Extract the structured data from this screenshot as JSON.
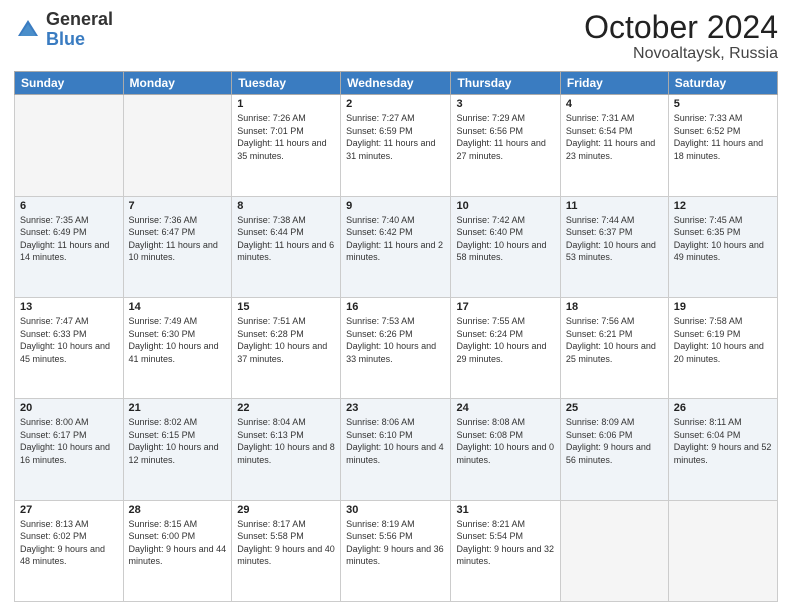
{
  "header": {
    "logo_general": "General",
    "logo_blue": "Blue",
    "month_title": "October 2024",
    "location": "Novoaltaysk, Russia"
  },
  "days_of_week": [
    "Sunday",
    "Monday",
    "Tuesday",
    "Wednesday",
    "Thursday",
    "Friday",
    "Saturday"
  ],
  "weeks": [
    [
      {
        "day": "",
        "empty": true
      },
      {
        "day": "",
        "empty": true
      },
      {
        "day": "1",
        "sunrise": "Sunrise: 7:26 AM",
        "sunset": "Sunset: 7:01 PM",
        "daylight": "Daylight: 11 hours and 35 minutes."
      },
      {
        "day": "2",
        "sunrise": "Sunrise: 7:27 AM",
        "sunset": "Sunset: 6:59 PM",
        "daylight": "Daylight: 11 hours and 31 minutes."
      },
      {
        "day": "3",
        "sunrise": "Sunrise: 7:29 AM",
        "sunset": "Sunset: 6:56 PM",
        "daylight": "Daylight: 11 hours and 27 minutes."
      },
      {
        "day": "4",
        "sunrise": "Sunrise: 7:31 AM",
        "sunset": "Sunset: 6:54 PM",
        "daylight": "Daylight: 11 hours and 23 minutes."
      },
      {
        "day": "5",
        "sunrise": "Sunrise: 7:33 AM",
        "sunset": "Sunset: 6:52 PM",
        "daylight": "Daylight: 11 hours and 18 minutes."
      }
    ],
    [
      {
        "day": "6",
        "sunrise": "Sunrise: 7:35 AM",
        "sunset": "Sunset: 6:49 PM",
        "daylight": "Daylight: 11 hours and 14 minutes."
      },
      {
        "day": "7",
        "sunrise": "Sunrise: 7:36 AM",
        "sunset": "Sunset: 6:47 PM",
        "daylight": "Daylight: 11 hours and 10 minutes."
      },
      {
        "day": "8",
        "sunrise": "Sunrise: 7:38 AM",
        "sunset": "Sunset: 6:44 PM",
        "daylight": "Daylight: 11 hours and 6 minutes."
      },
      {
        "day": "9",
        "sunrise": "Sunrise: 7:40 AM",
        "sunset": "Sunset: 6:42 PM",
        "daylight": "Daylight: 11 hours and 2 minutes."
      },
      {
        "day": "10",
        "sunrise": "Sunrise: 7:42 AM",
        "sunset": "Sunset: 6:40 PM",
        "daylight": "Daylight: 10 hours and 58 minutes."
      },
      {
        "day": "11",
        "sunrise": "Sunrise: 7:44 AM",
        "sunset": "Sunset: 6:37 PM",
        "daylight": "Daylight: 10 hours and 53 minutes."
      },
      {
        "day": "12",
        "sunrise": "Sunrise: 7:45 AM",
        "sunset": "Sunset: 6:35 PM",
        "daylight": "Daylight: 10 hours and 49 minutes."
      }
    ],
    [
      {
        "day": "13",
        "sunrise": "Sunrise: 7:47 AM",
        "sunset": "Sunset: 6:33 PM",
        "daylight": "Daylight: 10 hours and 45 minutes."
      },
      {
        "day": "14",
        "sunrise": "Sunrise: 7:49 AM",
        "sunset": "Sunset: 6:30 PM",
        "daylight": "Daylight: 10 hours and 41 minutes."
      },
      {
        "day": "15",
        "sunrise": "Sunrise: 7:51 AM",
        "sunset": "Sunset: 6:28 PM",
        "daylight": "Daylight: 10 hours and 37 minutes."
      },
      {
        "day": "16",
        "sunrise": "Sunrise: 7:53 AM",
        "sunset": "Sunset: 6:26 PM",
        "daylight": "Daylight: 10 hours and 33 minutes."
      },
      {
        "day": "17",
        "sunrise": "Sunrise: 7:55 AM",
        "sunset": "Sunset: 6:24 PM",
        "daylight": "Daylight: 10 hours and 29 minutes."
      },
      {
        "day": "18",
        "sunrise": "Sunrise: 7:56 AM",
        "sunset": "Sunset: 6:21 PM",
        "daylight": "Daylight: 10 hours and 25 minutes."
      },
      {
        "day": "19",
        "sunrise": "Sunrise: 7:58 AM",
        "sunset": "Sunset: 6:19 PM",
        "daylight": "Daylight: 10 hours and 20 minutes."
      }
    ],
    [
      {
        "day": "20",
        "sunrise": "Sunrise: 8:00 AM",
        "sunset": "Sunset: 6:17 PM",
        "daylight": "Daylight: 10 hours and 16 minutes."
      },
      {
        "day": "21",
        "sunrise": "Sunrise: 8:02 AM",
        "sunset": "Sunset: 6:15 PM",
        "daylight": "Daylight: 10 hours and 12 minutes."
      },
      {
        "day": "22",
        "sunrise": "Sunrise: 8:04 AM",
        "sunset": "Sunset: 6:13 PM",
        "daylight": "Daylight: 10 hours and 8 minutes."
      },
      {
        "day": "23",
        "sunrise": "Sunrise: 8:06 AM",
        "sunset": "Sunset: 6:10 PM",
        "daylight": "Daylight: 10 hours and 4 minutes."
      },
      {
        "day": "24",
        "sunrise": "Sunrise: 8:08 AM",
        "sunset": "Sunset: 6:08 PM",
        "daylight": "Daylight: 10 hours and 0 minutes."
      },
      {
        "day": "25",
        "sunrise": "Sunrise: 8:09 AM",
        "sunset": "Sunset: 6:06 PM",
        "daylight": "Daylight: 9 hours and 56 minutes."
      },
      {
        "day": "26",
        "sunrise": "Sunrise: 8:11 AM",
        "sunset": "Sunset: 6:04 PM",
        "daylight": "Daylight: 9 hours and 52 minutes."
      }
    ],
    [
      {
        "day": "27",
        "sunrise": "Sunrise: 8:13 AM",
        "sunset": "Sunset: 6:02 PM",
        "daylight": "Daylight: 9 hours and 48 minutes."
      },
      {
        "day": "28",
        "sunrise": "Sunrise: 8:15 AM",
        "sunset": "Sunset: 6:00 PM",
        "daylight": "Daylight: 9 hours and 44 minutes."
      },
      {
        "day": "29",
        "sunrise": "Sunrise: 8:17 AM",
        "sunset": "Sunset: 5:58 PM",
        "daylight": "Daylight: 9 hours and 40 minutes."
      },
      {
        "day": "30",
        "sunrise": "Sunrise: 8:19 AM",
        "sunset": "Sunset: 5:56 PM",
        "daylight": "Daylight: 9 hours and 36 minutes."
      },
      {
        "day": "31",
        "sunrise": "Sunrise: 8:21 AM",
        "sunset": "Sunset: 5:54 PM",
        "daylight": "Daylight: 9 hours and 32 minutes."
      },
      {
        "day": "",
        "empty": true
      },
      {
        "day": "",
        "empty": true
      }
    ]
  ]
}
